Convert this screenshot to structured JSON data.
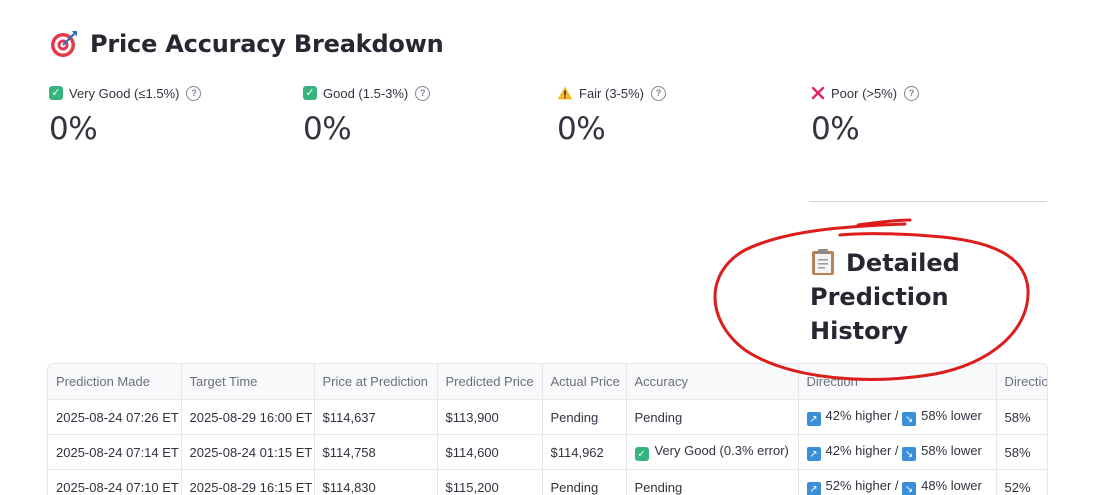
{
  "heading": {
    "title": "Price Accuracy Breakdown",
    "icon": "target-icon"
  },
  "metrics": [
    {
      "label": "Very Good (≤1.5%)",
      "value": "0%",
      "icon": "check-icon",
      "color": "#36b37e"
    },
    {
      "label": "Good (1.5-3%)",
      "value": "0%",
      "icon": "check-icon",
      "color": "#36b37e"
    },
    {
      "label": "Fair (3-5%)",
      "value": "0%",
      "icon": "warning-icon",
      "color": "#f5a623"
    },
    {
      "label": "Poor (>5%)",
      "value": "0%",
      "icon": "cross-icon",
      "color": "#e0245e"
    }
  ],
  "history": {
    "title": "Detailed Prediction History",
    "icon": "clipboard-icon"
  },
  "table": {
    "columns": [
      "Prediction Made",
      "Target Time",
      "Price at Prediction",
      "Predicted Price",
      "Actual Price",
      "Accuracy",
      "Direction",
      "Directio"
    ],
    "rows": [
      {
        "made": "2025-08-24 07:26 ET",
        "target": "2025-08-29 16:00 ET",
        "price_at": "$114,637",
        "predicted": "$113,900",
        "actual": "Pending",
        "accuracy": "Pending",
        "accuracy_check": false,
        "dir_up": "42% higher /",
        "dir_down": "58% lower",
        "dir_conf": "58%"
      },
      {
        "made": "2025-08-24 07:14 ET",
        "target": "2025-08-24 01:15 ET",
        "price_at": "$114,758",
        "predicted": "$114,600",
        "actual": "$114,962",
        "accuracy": "Very Good (0.3% error)",
        "accuracy_check": true,
        "dir_up": "42% higher /",
        "dir_down": "58% lower",
        "dir_conf": "58%"
      },
      {
        "made": "2025-08-24 07:10 ET",
        "target": "2025-08-29 16:15 ET",
        "price_at": "$114,830",
        "predicted": "$115,200",
        "actual": "Pending",
        "accuracy": "Pending",
        "accuracy_check": false,
        "dir_up": "52% higher /",
        "dir_down": "48% lower",
        "dir_conf": "52%"
      }
    ]
  },
  "colors": {
    "annotation": "#dd1c1c",
    "text": "#31333f",
    "header_bg": "#f8f9fb",
    "arrow": "#3b8fd9"
  }
}
